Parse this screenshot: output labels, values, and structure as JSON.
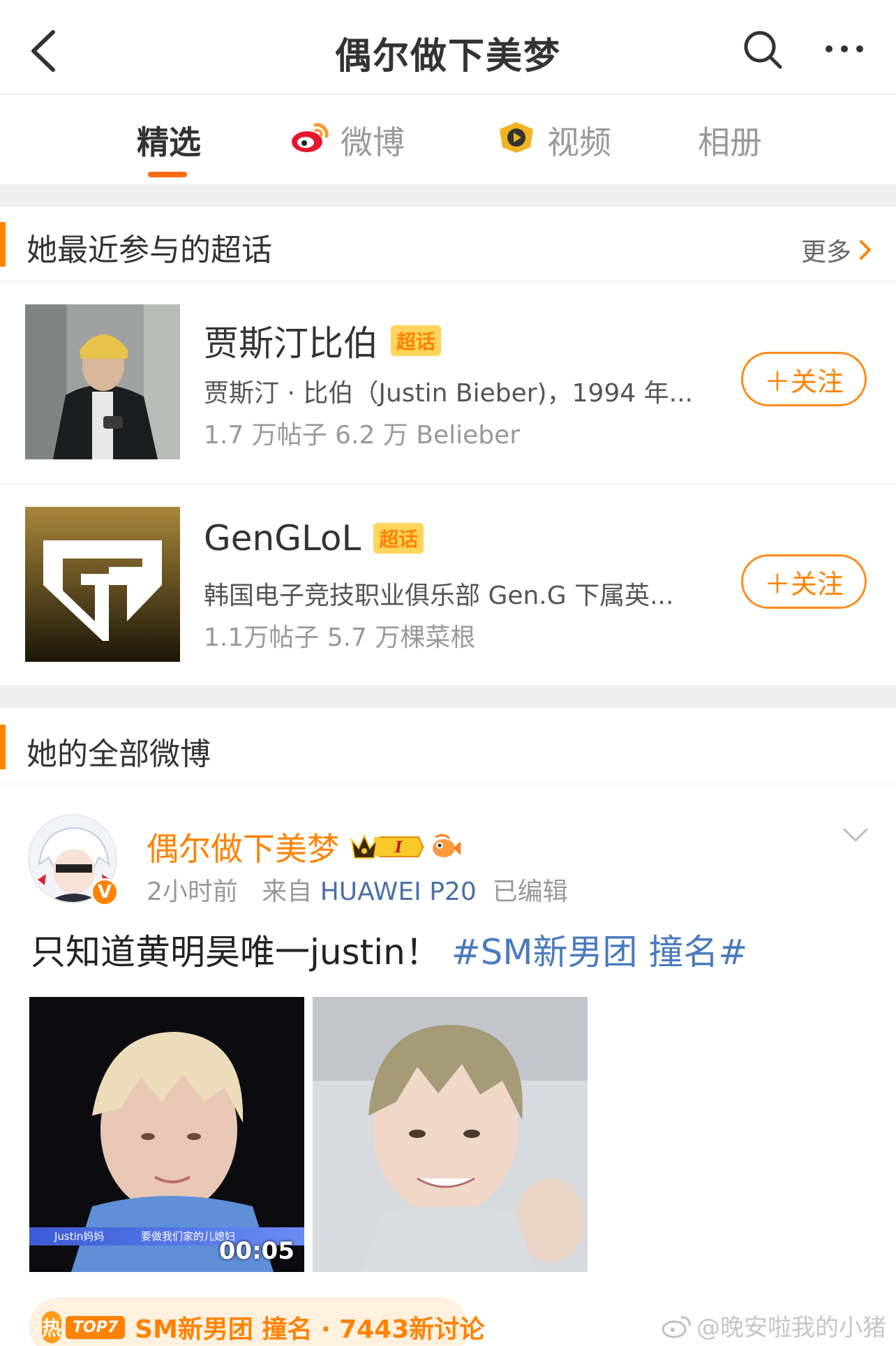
{
  "header": {
    "title": "偶尔做下美梦",
    "back_icon": "chevron-left-icon",
    "search_icon": "search-icon",
    "more_icon": "more-dots-icon"
  },
  "tabs": [
    {
      "label": "精选",
      "active": true
    },
    {
      "label": "微博",
      "icon": "weibo-icon"
    },
    {
      "label": "视频",
      "icon": "video-icon"
    },
    {
      "label": "相册"
    }
  ],
  "super_topics": {
    "title": "她最近参与的超话",
    "more_label": "更多",
    "items": [
      {
        "name": "贾斯汀比伯",
        "badge": "超话",
        "description": "贾斯汀 · 比伯（Justin Bieber)，1994 年...",
        "stats": "1.7 万帖子 6.2 万 Belieber",
        "follow_label": "＋关注"
      },
      {
        "name": "GenGLoL",
        "badge": "超话",
        "description": "韩国电子竞技职业俱乐部 Gen.G 下属英...",
        "stats": "1.1万帖子 5.7 万棵菜根",
        "follow_label": "＋关注"
      }
    ]
  },
  "all_posts": {
    "title": "她的全部微博"
  },
  "post": {
    "username": "偶尔做下美梦",
    "level_badge": "I",
    "time": "2小时前",
    "source_prefix": "来自",
    "device": "HUAWEI P20",
    "edited": "已编辑",
    "text_main": "只知道黄明昊唯一justin！",
    "hashtag": "#SM新男团 撞名#",
    "video": {
      "duration": "00:05",
      "caption_left": "Justin妈妈",
      "caption_right": "要做我们家的儿媳妇"
    },
    "hot_topic": {
      "hot_label": "热",
      "rank_label": "TOP7",
      "text": "SM新男团 撞名 · 7443新讨论"
    }
  },
  "watermark": "@晚安啦我的小猪",
  "colors": {
    "accent": "#ff8200",
    "link": "#4a7bbd",
    "tab_underline": "#ff6a13"
  }
}
